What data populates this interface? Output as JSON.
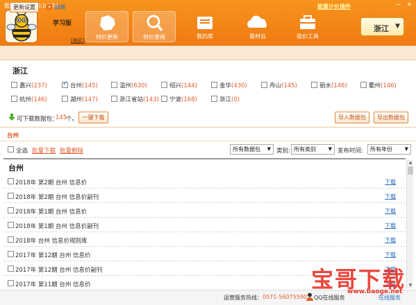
{
  "window": {
    "title": "我材助手 V2.0.0.774",
    "top_link": "能量计价插件",
    "min_icon": "minimize-icon",
    "close_icon": "close-icon"
  },
  "header": {
    "edition": "学习版",
    "buy_label": "[购买]",
    "nav": [
      {
        "label": "材价更新",
        "icon": "map-icon",
        "active": true
      },
      {
        "label": "材价查询",
        "icon": "search-icon",
        "active": true
      },
      {
        "label": "我的库",
        "icon": "folder-icon",
        "active": false
      },
      {
        "label": "我材云",
        "icon": "cloud-icon",
        "active": false
      },
      {
        "label": "造价工具",
        "icon": "toolbox-icon",
        "active": false
      }
    ],
    "region": "浙江"
  },
  "toolbar": {
    "update_settings": "更新设置",
    "refresh": "刷新"
  },
  "province": "浙江",
  "cities": [
    {
      "name": "嘉兴",
      "count": "(237)",
      "checked": false
    },
    {
      "name": "台州",
      "count": "(145)",
      "checked": true
    },
    {
      "name": "温州",
      "count": "(630)",
      "checked": false
    },
    {
      "name": "绍兴",
      "count": "(144)",
      "checked": false
    },
    {
      "name": "金华",
      "count": "(430)",
      "checked": false
    },
    {
      "name": "舟山",
      "count": "(145)",
      "checked": false
    },
    {
      "name": "丽水",
      "count": "(146)",
      "checked": false
    },
    {
      "name": "衢州",
      "count": "(146)",
      "checked": false
    },
    {
      "name": "杭州",
      "count": "(146)",
      "checked": false
    },
    {
      "name": "湖州",
      "count": "(147)",
      "checked": false
    },
    {
      "name": "浙江省站",
      "count": "(143)",
      "checked": false
    },
    {
      "name": "宁波",
      "count": "(168)",
      "checked": false
    },
    {
      "name": "浙江",
      "count": "(0)",
      "checked": false
    }
  ],
  "package": {
    "label": "可下载数据包：",
    "count": "145",
    "unit": "个。",
    "one_click": "一键下载",
    "import": "导入数据包",
    "export": "导出数据包"
  },
  "section_city": "台州",
  "filters": {
    "select_all": "全选",
    "batch_download": "批量下载",
    "batch_delete": "批量删除",
    "package_value": "所有数据包",
    "category_label": "类别:",
    "category_value": "所有类别",
    "date_label": "发布时间:",
    "date_value": "所有年份"
  },
  "list": {
    "title": "台州",
    "download_label": "下载",
    "rows": [
      "2018年 第2期 台州 信息价",
      "2018年 第2期 台州 信息价副刊",
      "2018年 第1期 台州 信息价",
      "2018年 第1期 台州 信息价副刊",
      "2018年 台州 信息价规则库",
      "2017年 第12期 台州 信息价",
      "2017年 第12期 台州 信息价副刊",
      "2017年 第11期 台州 信息价"
    ]
  },
  "status": {
    "hotline_label": "运营服务热线：",
    "hotline": "0571-56075590",
    "qq_label": "QQ在线服务",
    "online": "在线服务"
  },
  "watermark": {
    "text": "宝哥下载",
    "url": "www.baoge.net"
  },
  "colors": {
    "header": "#f7941d",
    "accent": "#e0592a",
    "link": "#2a6ebb"
  }
}
